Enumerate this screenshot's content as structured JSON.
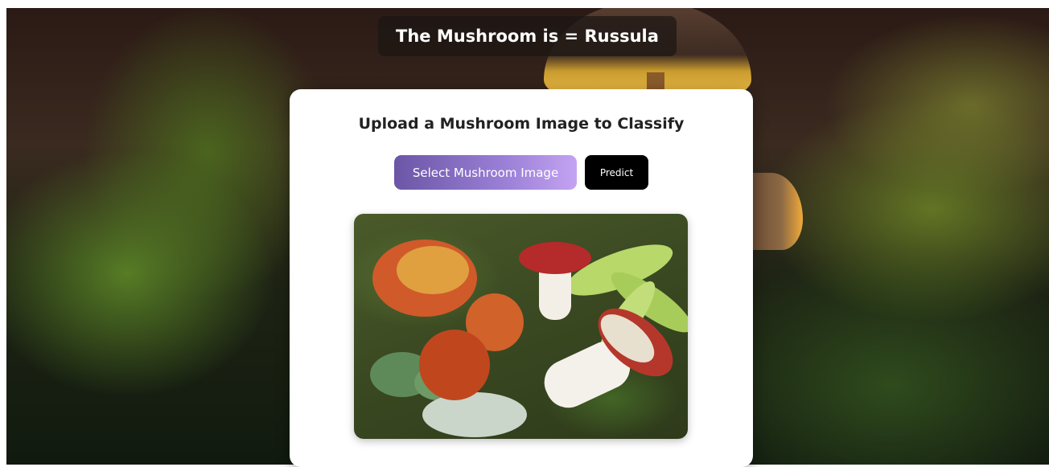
{
  "prediction": {
    "text": "The Mushroom is = Russula"
  },
  "upload_card": {
    "title": "Upload a Mushroom Image to Classify",
    "select_button_label": "Select Mushroom Image",
    "predict_button_label": "Predict",
    "preview_image": {
      "alt": "Uploaded mushroom photo"
    }
  },
  "colors": {
    "select_button_start": "#6b56a6",
    "select_button_end": "#c3a3f2",
    "predict_button": "#000000",
    "card_background": "#ffffff"
  }
}
